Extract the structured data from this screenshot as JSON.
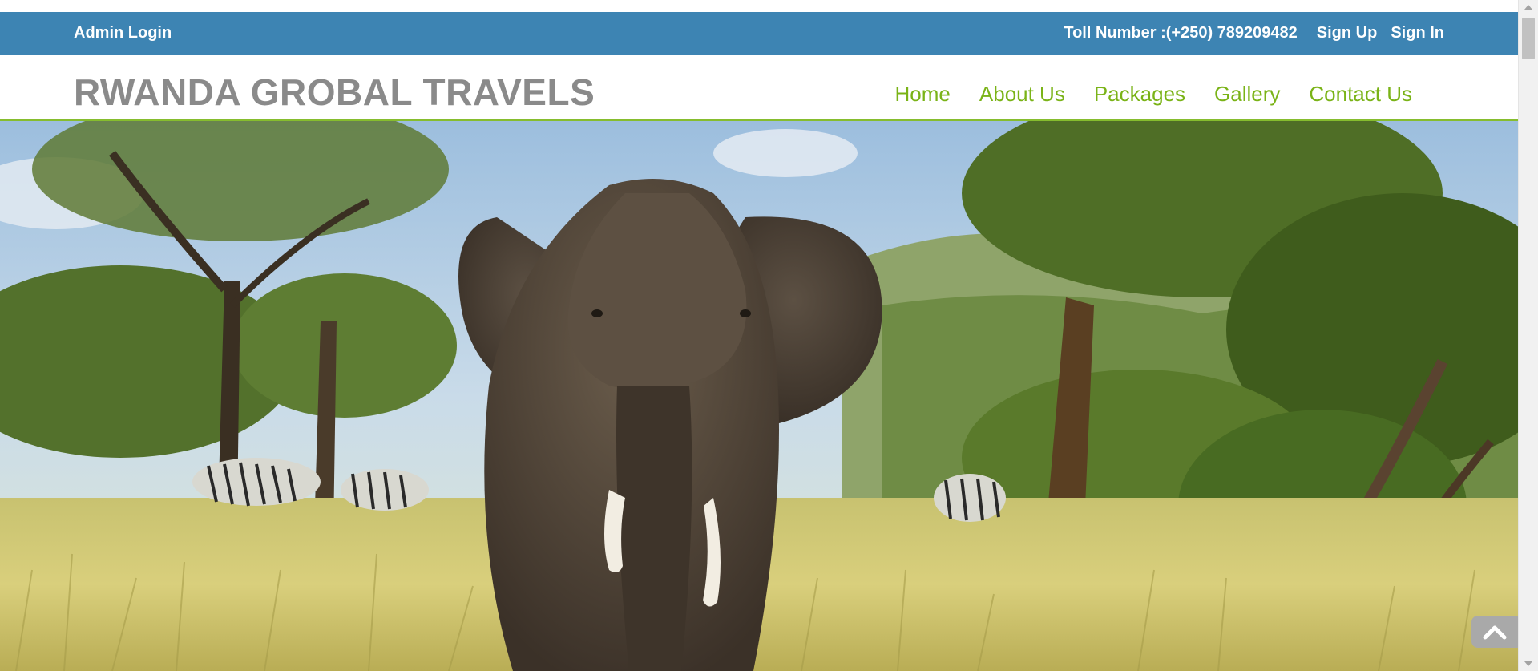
{
  "topbar": {
    "admin_login": "Admin Login",
    "toll_number": "Toll Number :(+250) 789209482",
    "sign_up": "Sign Up",
    "sign_in": "Sign In"
  },
  "header": {
    "brand": "RWANDA GROBAL TRAVELS",
    "nav": [
      "Home",
      "About Us",
      "Packages",
      "Gallery",
      "Contact Us"
    ]
  },
  "icons": {
    "scroll_top": "chevron-up-icon"
  },
  "colors": {
    "topbar_bg": "#3d84b3",
    "nav_green": "#7ab317",
    "brand_gray": "#8a8a8a",
    "header_border": "#86bd2e"
  }
}
